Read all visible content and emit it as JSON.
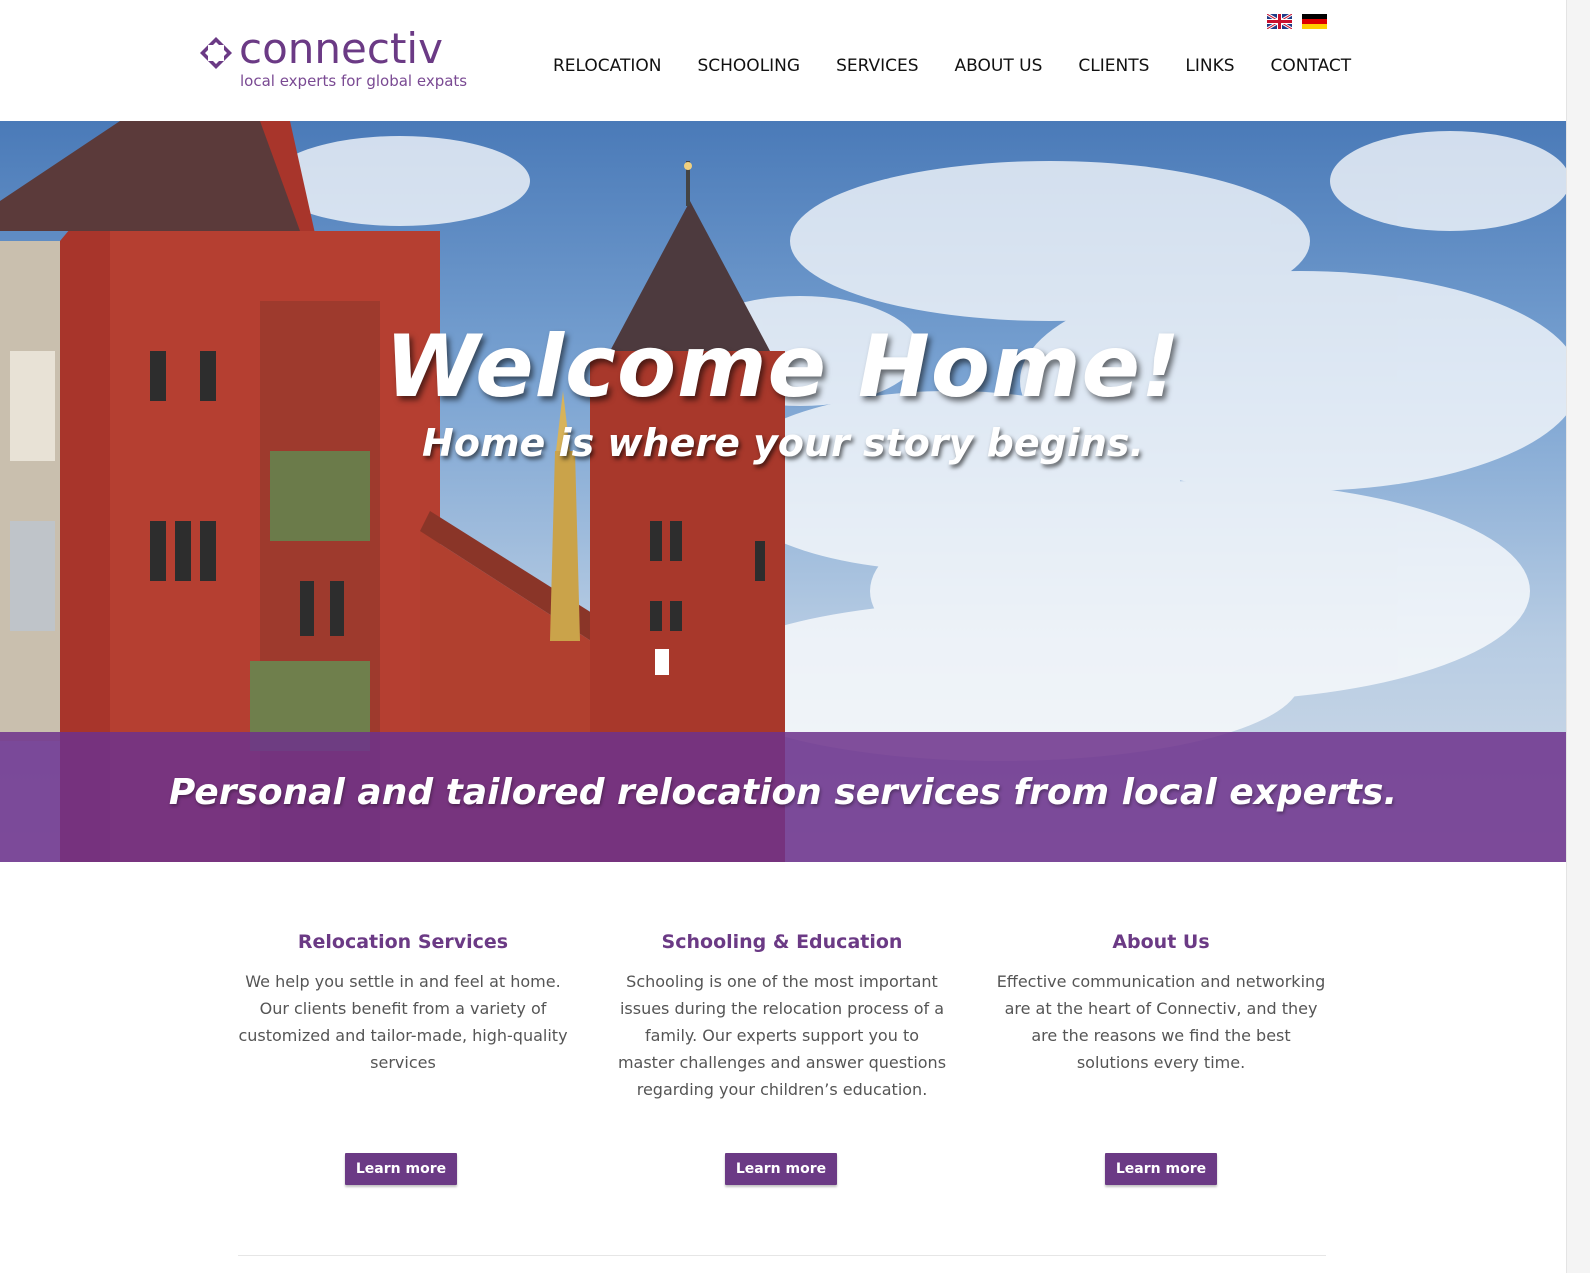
{
  "brand": {
    "name": "connectiv",
    "tagline": "local experts for global expats",
    "logo_icon": "diamond-arrows-icon",
    "accent_color": "#6b3a85"
  },
  "languages": [
    {
      "code": "en",
      "icon": "uk-flag-icon"
    },
    {
      "code": "de",
      "icon": "german-flag-icon"
    }
  ],
  "nav": {
    "items": [
      "RELOCATION",
      "SCHOOLING",
      "SERVICES",
      "ABOUT US",
      "CLIENTS",
      "LINKS",
      "CONTACT"
    ]
  },
  "hero": {
    "title": "Welcome Home!",
    "subtitle": "Home is where your story begins.",
    "band_text": "Personal and tailored relocation services from local experts."
  },
  "features": [
    {
      "title": "Relocation Services",
      "text": "We help you settle in and feel at home. Our clients benefit from a variety of customized and tailor-made, high-quality services",
      "button": "Learn more"
    },
    {
      "title": "Schooling & Education",
      "text": "Schooling is one of the most important issues during the relocation process of a family. Our experts support you to master challenges and answer questions regarding your children’s education.",
      "button": "Learn more"
    },
    {
      "title": "About Us",
      "text": "Effective communication and networking are at the heart of Connectiv, and they are the reasons we find the best solutions every time.",
      "button": "Learn more"
    }
  ]
}
